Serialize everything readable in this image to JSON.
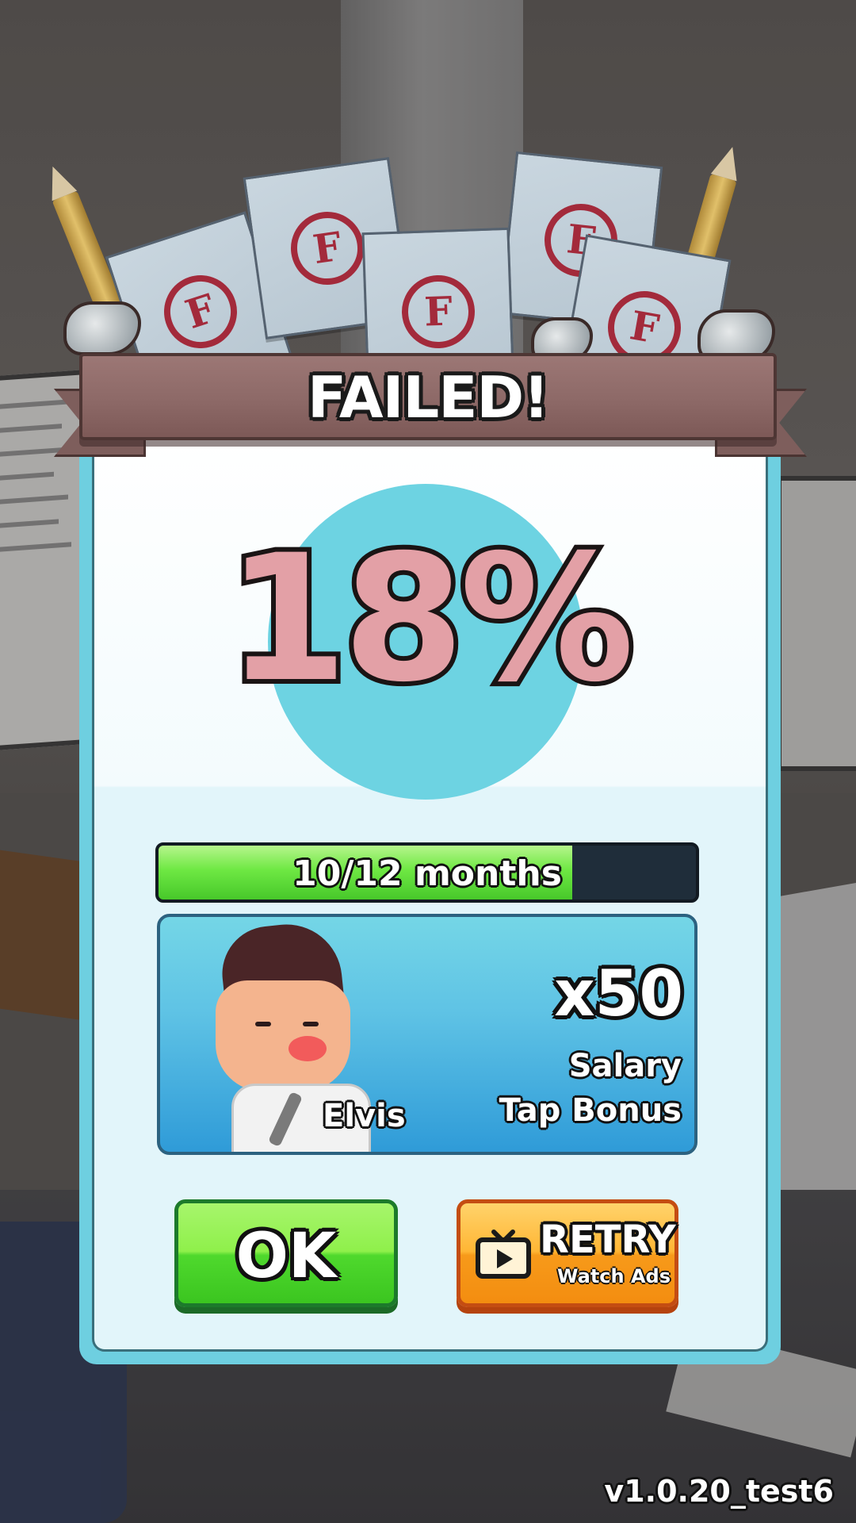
{
  "result_dialog": {
    "title": "FAILED!",
    "score": "18%",
    "paper_grade": "F"
  },
  "progress": {
    "label": "10/12 months",
    "fraction": 0.77
  },
  "reward": {
    "character_name": "Elvis",
    "multiplier": "x50",
    "bonus_line1": "Salary",
    "bonus_line2": "Tap Bonus"
  },
  "buttons": {
    "ok_label": "OK",
    "retry_label": "RETRY",
    "retry_sub": "Watch Ads"
  },
  "version": "v1.0.20_test6",
  "colors": {
    "score_fill": "#e3a0a6",
    "score_circle": "#6dd3e2",
    "banner": "#8d6967",
    "ok_green": "#4fd92d",
    "retry_orange": "#f79a1a",
    "progress_green": "#6ee843"
  },
  "icons": {
    "retry_icon": "tv-play-icon",
    "grade_icon": "grade-f-stamp-icon"
  }
}
